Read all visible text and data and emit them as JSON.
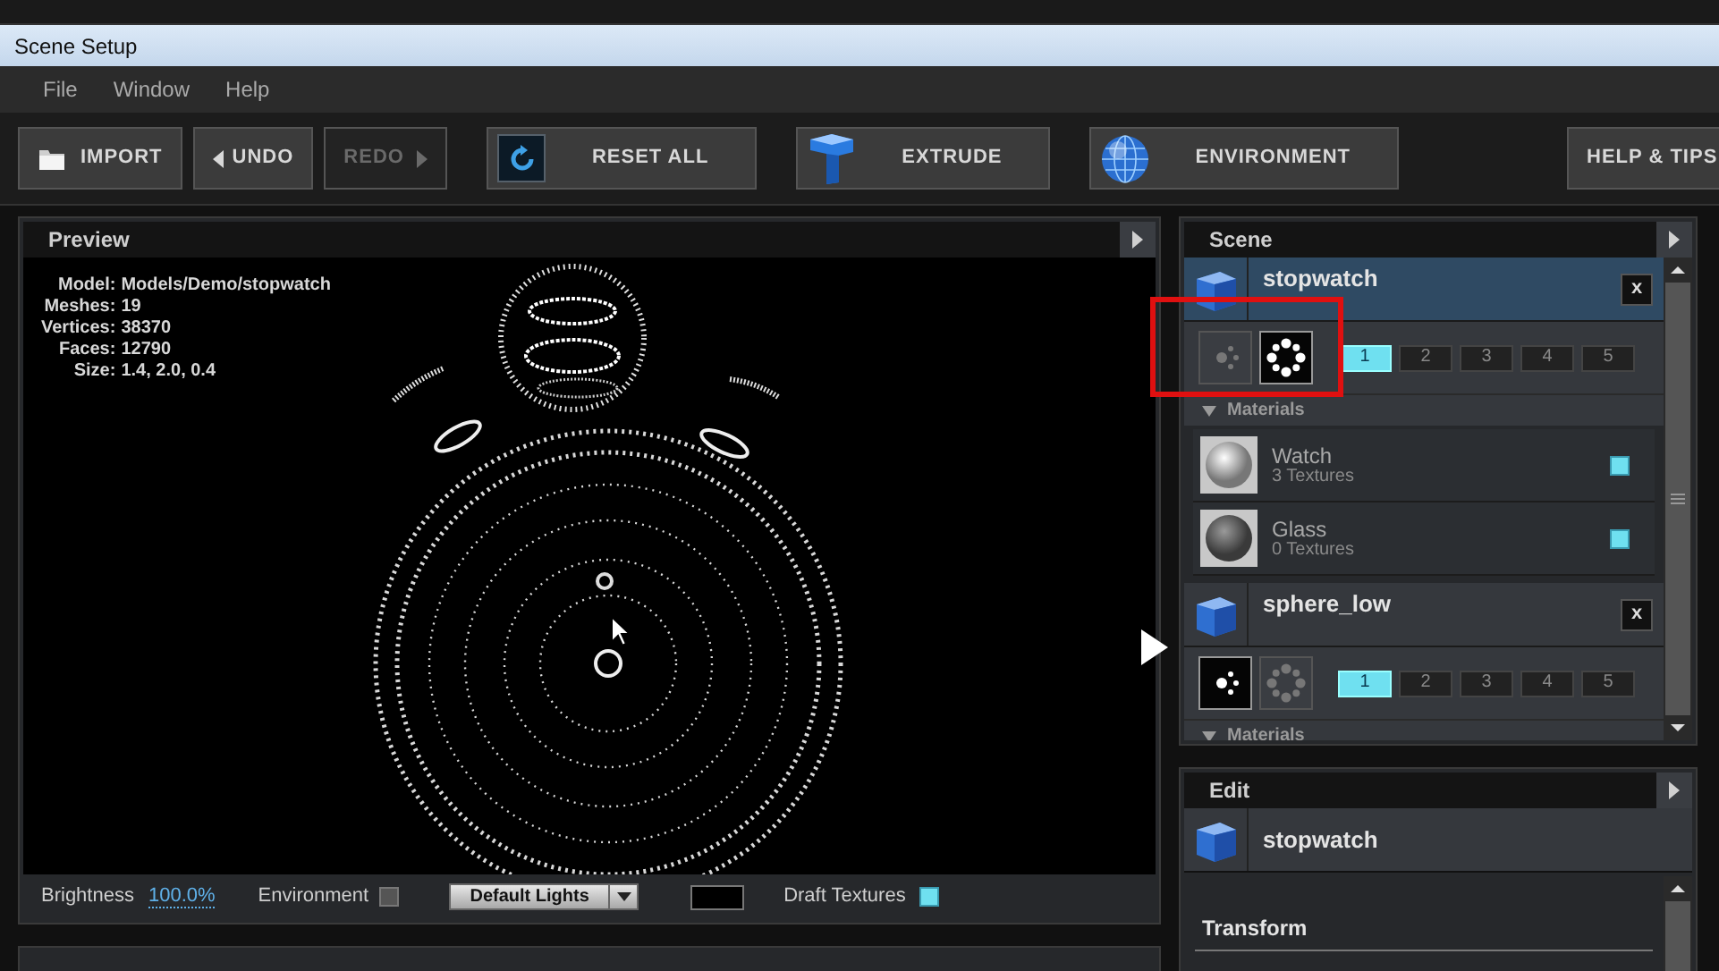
{
  "window": {
    "title": "Scene Setup"
  },
  "menu": [
    "File",
    "Window",
    "Help"
  ],
  "toolbar": [
    {
      "kind": "import",
      "label": "IMPORT",
      "disabled": false
    },
    {
      "kind": "undo",
      "label": "UNDO",
      "disabled": false
    },
    {
      "kind": "redo",
      "label": "REDO",
      "disabled": true
    },
    {
      "kind": "reset",
      "label": "RESET ALL",
      "disabled": false
    },
    {
      "kind": "extrude",
      "label": "EXTRUDE",
      "disabled": false
    },
    {
      "kind": "environment",
      "label": "ENVIRONMENT",
      "disabled": false
    },
    {
      "kind": "help",
      "label": "HELP & TIPS",
      "disabled": false
    }
  ],
  "preview": {
    "title": "Preview",
    "info": [
      {
        "label": "Model:",
        "value": "Models/Demo/stopwatch"
      },
      {
        "label": "Meshes:",
        "value": "19"
      },
      {
        "label": "Vertices:",
        "value": "38370"
      },
      {
        "label": "Faces:",
        "value": "12790"
      },
      {
        "label": "Size:",
        "value": "1.4, 2.0, 0.4"
      }
    ],
    "brightness": {
      "label": "Brightness",
      "value": "100.0%"
    },
    "environment": {
      "label": "Environment",
      "checked": false
    },
    "lights": {
      "value": "Default Lights"
    },
    "draft_textures": {
      "label": "Draft Textures",
      "checked": true
    }
  },
  "scene": {
    "title": "Scene",
    "objects": [
      {
        "name": "stopwatch",
        "selected": true,
        "modes": [
          {
            "kind": "points",
            "selected": false
          },
          {
            "kind": "ring",
            "selected": true
          }
        ],
        "lods": [
          {
            "label": "1",
            "selected": true
          },
          {
            "label": "2",
            "selected": false
          },
          {
            "label": "3",
            "selected": false
          },
          {
            "label": "4",
            "selected": false
          },
          {
            "label": "5",
            "selected": false
          }
        ],
        "close": "x",
        "materials_label": "Materials",
        "expanded": true,
        "materials": [
          {
            "name": "Watch",
            "textures": "3 Textures",
            "kind": "chrome",
            "visible": true
          },
          {
            "name": "Glass",
            "textures": "0 Textures",
            "kind": "matte",
            "visible": true
          }
        ]
      },
      {
        "name": "sphere_low",
        "selected": false,
        "modes": [
          {
            "kind": "points",
            "selected": true
          },
          {
            "kind": "ring",
            "selected": false
          }
        ],
        "lods": [
          {
            "label": "1",
            "selected": true
          },
          {
            "label": "2",
            "selected": false
          },
          {
            "label": "3",
            "selected": false
          },
          {
            "label": "4",
            "selected": false
          },
          {
            "label": "5",
            "selected": false
          }
        ],
        "close": "x",
        "materials_label": "Materials",
        "expanded": true
      }
    ]
  },
  "edit": {
    "title": "Edit",
    "object": "stopwatch",
    "section": "Transform"
  }
}
